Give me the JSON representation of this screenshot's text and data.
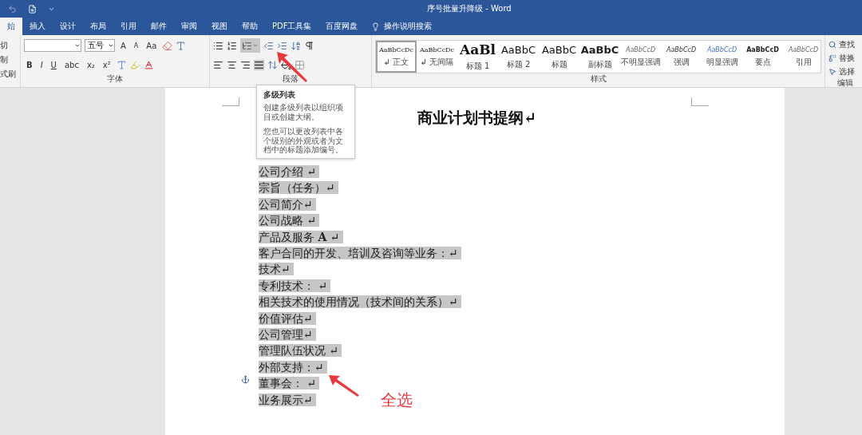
{
  "window": {
    "title": "序号批量升降级  -  Word"
  },
  "tabs": [
    {
      "label": "始",
      "selected": true
    },
    {
      "label": "插入",
      "selected": false
    },
    {
      "label": "设计",
      "selected": false
    },
    {
      "label": "布局",
      "selected": false
    },
    {
      "label": "引用",
      "selected": false
    },
    {
      "label": "邮件",
      "selected": false
    },
    {
      "label": "审阅",
      "selected": false
    },
    {
      "label": "视图",
      "selected": false
    },
    {
      "label": "帮助",
      "selected": false
    },
    {
      "label": "PDF工具集",
      "selected": false
    },
    {
      "label": "百度网盘",
      "selected": false
    }
  ],
  "tell_me": {
    "placeholder": "操作说明搜索"
  },
  "clipboard": {
    "items": [
      "切",
      "制",
      "式刷"
    ]
  },
  "font_group": {
    "label": "字体",
    "font_size": "五号",
    "size_buttons": [
      "A",
      "A",
      "Aa"
    ],
    "format_buttons": [
      "B",
      "I",
      "U",
      "abc",
      "x₂",
      "x²"
    ]
  },
  "paragraph_group": {
    "label": "段落",
    "multilevel_list": {
      "active": true
    }
  },
  "styles_group": {
    "label": "样式",
    "items": [
      {
        "preview": "AaBbCcDc",
        "label": "↲ 正文",
        "kind": "normal",
        "selected": true
      },
      {
        "preview": "AaBbCcDc",
        "label": "↲ 无间隔",
        "kind": "normal",
        "selected": false
      },
      {
        "preview": "AaBl",
        "label": "标题 1",
        "kind": "heading1",
        "selected": false
      },
      {
        "preview": "AaBbC",
        "label": "标题 2",
        "kind": "heading2",
        "selected": false
      },
      {
        "preview": "AaBbC",
        "label": "标题",
        "kind": "heading2",
        "selected": false
      },
      {
        "preview": "AaBbC",
        "label": "副标题",
        "kind": "subtitle",
        "selected": false
      },
      {
        "preview": "AaBbCcD",
        "label": "不明显强调",
        "kind": "subtle",
        "selected": false
      },
      {
        "preview": "AaBbCcD",
        "label": "强调",
        "kind": "emphasis",
        "selected": false
      },
      {
        "preview": "AaBbCcD",
        "label": "明显强调",
        "kind": "intense",
        "selected": false
      },
      {
        "preview": "AaBbCcD",
        "label": "要点",
        "kind": "strong",
        "selected": false
      },
      {
        "preview": "AaBbCcD",
        "label": "引用",
        "kind": "subtle",
        "selected": false
      }
    ]
  },
  "editing_group": {
    "label": "编辑",
    "items": [
      "查找",
      "替换",
      "选择"
    ]
  },
  "tooltip": {
    "title": "多级列表",
    "lines": [
      "创建多级列表以组织项目或创建大纲。",
      "您也可以更改列表中各个级别的外观或者为文档中的标题添加编号。"
    ]
  },
  "document": {
    "title": "商业计划书提纲↵",
    "paragraphs": [
      {
        "text": "公司介绍 ↵",
        "selected": true
      },
      {
        "text": "宗旨（任务）↵",
        "selected": true
      },
      {
        "text": "公司简介↵",
        "selected": true
      },
      {
        "text": "公司战略 ↵",
        "selected": true
      },
      {
        "text": "产品及服务 **A** ↵",
        "selected": true
      },
      {
        "text": "客户合同的开发、培训及咨询等业务：↵",
        "selected": true
      },
      {
        "text": "技术↵",
        "selected": true
      },
      {
        "text": "专利技术：  ↵",
        "selected": true
      },
      {
        "text": "相关技术的使用情况（技术间的关系）↵",
        "selected": true
      },
      {
        "text": "价值评估↵",
        "selected": true
      },
      {
        "text": "公司管理↵",
        "selected": true
      },
      {
        "text": "管理队伍状况 ↵",
        "selected": true
      },
      {
        "text": "外部支持：↵",
        "selected": true
      },
      {
        "text": "董事会： ↵",
        "selected": true
      },
      {
        "text": "业务展示↵",
        "selected": true
      }
    ]
  },
  "annotation": {
    "text": "全选"
  }
}
